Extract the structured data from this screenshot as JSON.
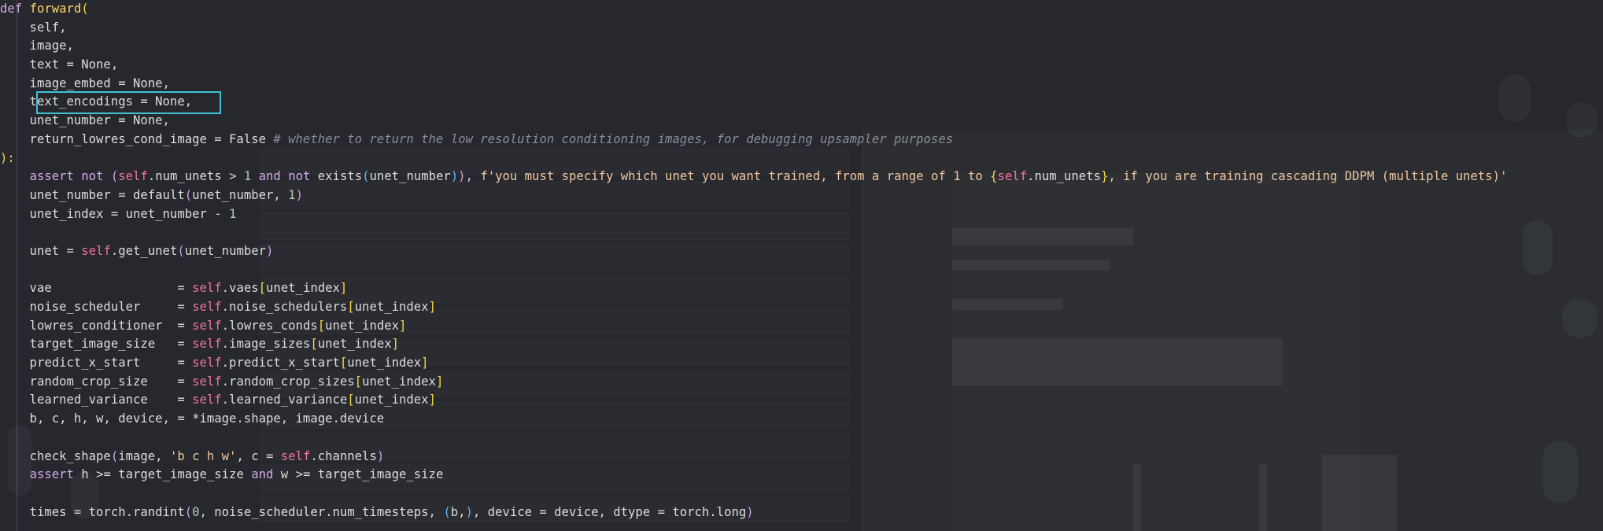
{
  "code_lines": [
    [
      [
        "kw",
        "def"
      ],
      [
        "op",
        " "
      ],
      [
        "fn",
        "forward"
      ],
      [
        "br1",
        "("
      ]
    ],
    [
      [
        "op",
        "    self,"
      ]
    ],
    [
      [
        "op",
        "    image,"
      ]
    ],
    [
      [
        "op",
        "    text = None,"
      ]
    ],
    [
      [
        "op",
        "    image_embed = None,"
      ]
    ],
    [
      [
        "op",
        "    text_encodings = None,"
      ]
    ],
    [
      [
        "op",
        "    unet_number = None,"
      ]
    ],
    [
      [
        "op",
        "    return_lowres_cond_image = False "
      ],
      [
        "cm",
        "# whether to return the low resolution conditioning images, for debugging upsampler purposes"
      ]
    ],
    [
      [
        "br1",
        "):"
      ]
    ],
    [
      [
        "op",
        "    "
      ],
      [
        "kw",
        "assert"
      ],
      [
        "op",
        " "
      ],
      [
        "kw",
        "not"
      ],
      [
        "op",
        " "
      ],
      [
        "br2",
        "("
      ],
      [
        "self",
        "self"
      ],
      [
        "op",
        ".num_unets > "
      ],
      [
        "num",
        "1"
      ],
      [
        "op",
        " "
      ],
      [
        "kw",
        "and"
      ],
      [
        "op",
        " "
      ],
      [
        "kw",
        "not"
      ],
      [
        "op",
        " exists"
      ],
      [
        "br3",
        "("
      ],
      [
        "op",
        "unet_number"
      ],
      [
        "br3",
        ")"
      ],
      [
        "br2",
        ")"
      ],
      [
        "op",
        ", "
      ],
      [
        "str",
        "f'you must specify which unet you want trained, from a range of 1 to "
      ],
      [
        "br1",
        "{"
      ],
      [
        "self",
        "self"
      ],
      [
        "op",
        ".num_unets"
      ],
      [
        "br1",
        "}"
      ],
      [
        "str",
        ", if you are training cascading DDPM (multiple unets)'"
      ]
    ],
    [
      [
        "op",
        "    unet_number = default"
      ],
      [
        "br2",
        "("
      ],
      [
        "op",
        "unet_number, "
      ],
      [
        "num",
        "1"
      ],
      [
        "br2",
        ")"
      ]
    ],
    [
      [
        "op",
        "    unet_index = unet_number - "
      ],
      [
        "num",
        "1"
      ]
    ],
    [
      [
        "op",
        ""
      ]
    ],
    [
      [
        "op",
        "    unet = "
      ],
      [
        "self",
        "self"
      ],
      [
        "op",
        ".get_unet"
      ],
      [
        "br2",
        "("
      ],
      [
        "op",
        "unet_number"
      ],
      [
        "br2",
        ")"
      ]
    ],
    [
      [
        "op",
        ""
      ]
    ],
    [
      [
        "op",
        "    vae                 = "
      ],
      [
        "self",
        "self"
      ],
      [
        "op",
        ".vaes"
      ],
      [
        "br1",
        "["
      ],
      [
        "op",
        "unet_index"
      ],
      [
        "br1",
        "]"
      ]
    ],
    [
      [
        "op",
        "    noise_scheduler     = "
      ],
      [
        "self",
        "self"
      ],
      [
        "op",
        ".noise_schedulers"
      ],
      [
        "br1",
        "["
      ],
      [
        "op",
        "unet_index"
      ],
      [
        "br1",
        "]"
      ]
    ],
    [
      [
        "op",
        "    lowres_conditioner  = "
      ],
      [
        "self",
        "self"
      ],
      [
        "op",
        ".lowres_conds"
      ],
      [
        "br1",
        "["
      ],
      [
        "op",
        "unet_index"
      ],
      [
        "br1",
        "]"
      ]
    ],
    [
      [
        "op",
        "    target_image_size   = "
      ],
      [
        "self",
        "self"
      ],
      [
        "op",
        ".image_sizes"
      ],
      [
        "br1",
        "["
      ],
      [
        "op",
        "unet_index"
      ],
      [
        "br1",
        "]"
      ]
    ],
    [
      [
        "op",
        "    predict_x_start     = "
      ],
      [
        "self",
        "self"
      ],
      [
        "op",
        ".predict_x_start"
      ],
      [
        "br1",
        "["
      ],
      [
        "op",
        "unet_index"
      ],
      [
        "br1",
        "]"
      ]
    ],
    [
      [
        "op",
        "    random_crop_size    = "
      ],
      [
        "self",
        "self"
      ],
      [
        "op",
        ".random_crop_sizes"
      ],
      [
        "br1",
        "["
      ],
      [
        "op",
        "unet_index"
      ],
      [
        "br1",
        "]"
      ]
    ],
    [
      [
        "op",
        "    learned_variance    = "
      ],
      [
        "self",
        "self"
      ],
      [
        "op",
        ".learned_variance"
      ],
      [
        "br1",
        "["
      ],
      [
        "op",
        "unet_index"
      ],
      [
        "br1",
        "]"
      ]
    ],
    [
      [
        "op",
        "    b, c, h, w, device, = *image.shape, image.device"
      ]
    ],
    [
      [
        "op",
        ""
      ]
    ],
    [
      [
        "op",
        "    check_shape"
      ],
      [
        "br2",
        "("
      ],
      [
        "op",
        "image, "
      ],
      [
        "str",
        "'b c h w'"
      ],
      [
        "op",
        ", c = "
      ],
      [
        "self",
        "self"
      ],
      [
        "op",
        ".channels"
      ],
      [
        "br2",
        ")"
      ]
    ],
    [
      [
        "op",
        "    "
      ],
      [
        "kw",
        "assert"
      ],
      [
        "op",
        " h >= target_image_size "
      ],
      [
        "kw",
        "and"
      ],
      [
        "op",
        " w >= target_image_size"
      ]
    ],
    [
      [
        "op",
        ""
      ]
    ],
    [
      [
        "op",
        "    times = torch.randint"
      ],
      [
        "br2",
        "("
      ],
      [
        "num",
        "0"
      ],
      [
        "op",
        ", noise_scheduler.num_timesteps, "
      ],
      [
        "br3",
        "("
      ],
      [
        "op",
        "b,"
      ],
      [
        "br3",
        ")"
      ],
      [
        "op",
        ", device = device, dtype = torch.long"
      ],
      [
        "br2",
        ")"
      ]
    ]
  ],
  "highlight": {
    "text": "text_encodings = None,",
    "color": "#3fc1d2"
  }
}
